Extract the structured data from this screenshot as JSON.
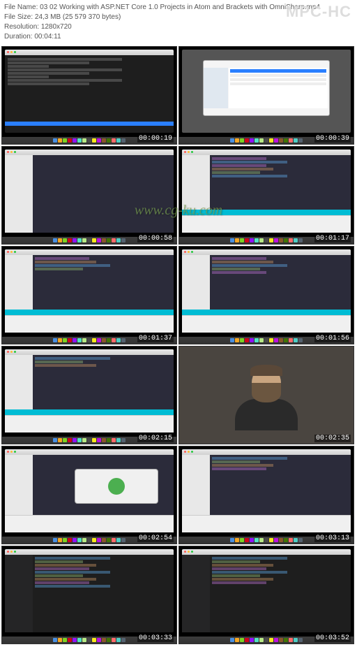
{
  "header": {
    "filename_label": "File Name:",
    "filename": "03 02 Working with ASP.NET Core 1.0 Projects in Atom and Brackets with OmniSharp.mp4",
    "filesize_label": "File Size:",
    "filesize": "24,3 MB (25 579 370 bytes)",
    "resolution_label": "Resolution:",
    "resolution": "1280x720",
    "duration_label": "Duration:",
    "duration": "00:04:11",
    "app_logo": "MPC-HC"
  },
  "watermark": "www.cg-ku.com",
  "timestamps": [
    "00:00:19",
    "00:00:39",
    "00:00:58",
    "00:01:17",
    "00:01:37",
    "00:01:56",
    "00:02:15",
    "00:02:35",
    "00:02:54",
    "00:03:13",
    "00:03:33",
    "00:03:52"
  ],
  "dock_colors": [
    "#4a90e2",
    "#f5a623",
    "#7ed321",
    "#d0021b",
    "#9013fe",
    "#50e3c2",
    "#b8e986",
    "#4a4a4a",
    "#f8e71c",
    "#bd10e0",
    "#8b572a",
    "#417505",
    "#ff6b6b",
    "#4ecdc4",
    "#556270"
  ]
}
